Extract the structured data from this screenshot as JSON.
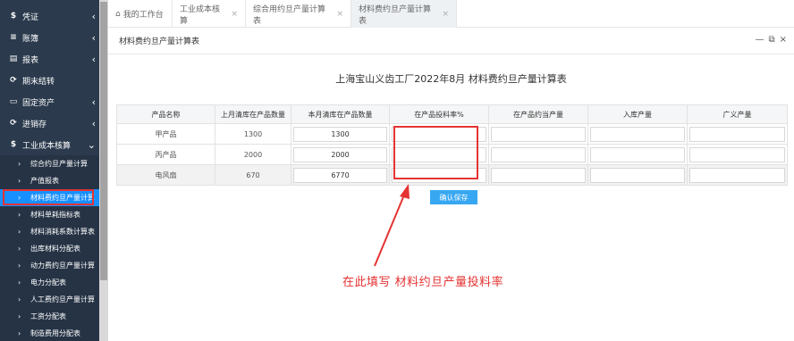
{
  "sidebar": {
    "menu": [
      {
        "icon": "$",
        "label": "凭证"
      },
      {
        "icon": "≡",
        "label": "账簿"
      },
      {
        "icon": "▤",
        "label": "报表"
      },
      {
        "icon": "⟳",
        "label": "期末结转"
      },
      {
        "icon": "▭",
        "label": "固定资产"
      },
      {
        "icon": "⟳",
        "label": "进销存"
      },
      {
        "icon": "$",
        "label": "工业成本核算"
      }
    ],
    "sub_items": [
      "综合约旦产量计算",
      "产值报表",
      "材料费约旦产量计算",
      "材料单耗指标表",
      "材料消耗系数计算表",
      "出库材料分配表",
      "动力费约旦产量计算",
      "电力分配表",
      "人工费约旦产量计算",
      "工资分配表",
      "制造费用分配表"
    ]
  },
  "tabs": [
    {
      "label": "我的工作台"
    },
    {
      "label": "工业成本核算"
    },
    {
      "label": "综合用约旦产量计算表"
    },
    {
      "label": "材料费约旦产量计算表"
    }
  ],
  "panel": {
    "title": "材料费约旦产量计算表"
  },
  "report": {
    "title": "上海宝山义齿工厂2022年8月 材料费约旦产量计算表"
  },
  "table": {
    "headers": [
      "产品名称",
      "上月清库在产品数量",
      "本月清库在产品数量",
      "在产品投料率%",
      "在产品约当产量",
      "入库产量",
      "广义产量"
    ],
    "rows": [
      {
        "name": "甲产品",
        "last": "1300",
        "current": "1300"
      },
      {
        "name": "丙产品",
        "last": "2000",
        "current": "2000"
      },
      {
        "name": "电风扇",
        "last": "670",
        "current": "6770"
      }
    ]
  },
  "buttons": {
    "save": "确认保存"
  },
  "annotation": "在此填写  材料约旦产量投料率",
  "colors": {
    "sidebar": "#2b3a4d",
    "active": "#1890ff",
    "accent_red": "#e53333",
    "button": "#37a7f2"
  }
}
